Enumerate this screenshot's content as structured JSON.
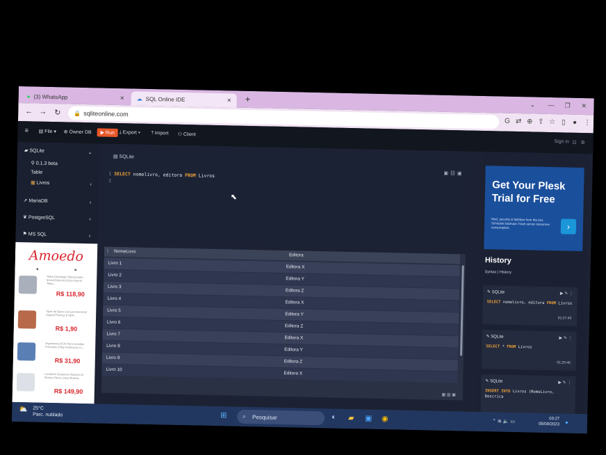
{
  "browser": {
    "tabs": [
      {
        "label": "(3) WhatsApp",
        "icon": "whatsapp-icon"
      },
      {
        "label": "SQL Online IDE",
        "icon": "cloud-icon"
      }
    ],
    "url": "sqliteonline.com"
  },
  "toolbar": {
    "file": "File",
    "owner_db": "Owner DB",
    "run": "Run",
    "export": "Export",
    "import": "Import",
    "client": "Client",
    "sign_in": "Sign in"
  },
  "sidebar": {
    "items": [
      {
        "label": "SQLite"
      },
      {
        "label": "0.1.3 beta"
      },
      {
        "label": "Table"
      },
      {
        "label": "Livros"
      },
      {
        "label": "MariaDB"
      },
      {
        "label": "PostgreSQL"
      },
      {
        "label": "MS SQL"
      }
    ]
  },
  "ad": {
    "brand": "Amoedo",
    "products": [
      {
        "desc": "Telha Ondulada Fibrocimento 6mmX244cmX110cm Eternit Telha...",
        "price": "R$ 118,90"
      },
      {
        "desc": "Tijolo de Barro Comum 8X20X18 Jagum/Thomaz 8 SER...",
        "price": "R$ 1,90"
      },
      {
        "desc": "Argamassa ACIII Para Grandes Formatos 20kg Votomassa Ci...",
        "price": "R$ 31,90"
      },
      {
        "desc": "Lavatório Suspenso Ravena 44 Branco Deca Louça Branca...",
        "price": "R$ 149,90"
      }
    ]
  },
  "editor": {
    "title": "SQLite",
    "lines": [
      {
        "num": "1",
        "kw1": "SELECT",
        "t1": " nomelivro, editora ",
        "kw2": "FROM",
        "t2": " Livros"
      },
      {
        "num": "2",
        "kw1": "",
        "t1": "",
        "kw2": "",
        "t2": ""
      }
    ]
  },
  "results": {
    "columns": [
      "NomeLivro",
      "Editora"
    ],
    "rows": [
      [
        "Livro 1",
        "Editora X"
      ],
      [
        "Livro 2",
        "Editora Y"
      ],
      [
        "Livro 3",
        "Editora Z"
      ],
      [
        "Livro 4",
        "Editora X"
      ],
      [
        "Livro 5",
        "Editora Y"
      ],
      [
        "Livro 6",
        "Editora Z"
      ],
      [
        "Livro 7",
        "Editora X"
      ],
      [
        "Livro 8",
        "Editora Y"
      ],
      [
        "Livro 9",
        "Editora Z"
      ],
      [
        "Livro 10",
        "Editora X"
      ]
    ]
  },
  "banner": {
    "title": "Get Your Plesk Trial for Free",
    "text": "Mod_security & fail2ban from the box. Schedule backups.Track server resources consumption."
  },
  "history": {
    "title": "History",
    "subtitle": "Syntax | History",
    "entries": [
      {
        "db": "SQLite",
        "kw1": "SELECT",
        "t1": " nomelivro, editora ",
        "kw2": "FROM",
        "t2": " Livros",
        "time": "01:27:43"
      },
      {
        "db": "SQLite",
        "kw1": "SELECT",
        "t1": " * ",
        "kw2": "FROM",
        "t2": " Livros",
        "time": "01:25:40"
      },
      {
        "db": "SQLite",
        "kw1": "INSERT INTO",
        "t1": " Livros (NomeLivro, Descrica",
        "kw2": "",
        "t2": "",
        "time": ""
      }
    ]
  },
  "taskbar": {
    "temperature": "25°C",
    "weather": "Parc. nublado",
    "search": "Pesquisar",
    "time": "03:27",
    "date": "05/09/2023"
  }
}
